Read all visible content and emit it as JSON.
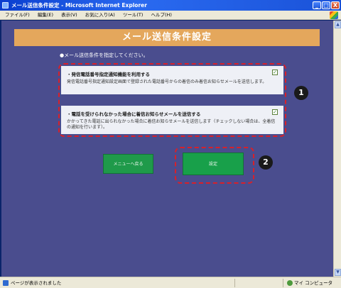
{
  "window": {
    "title": "メール送信条件設定 - Microsoft Internet Explorer",
    "minimize_glyph": "_",
    "maximize_glyph": "□",
    "close_glyph": "X"
  },
  "menubar": {
    "items": [
      "ファイル(F)",
      "編集(E)",
      "表示(V)",
      "お気に入り(A)",
      "ツール(T)",
      "ヘルプ(H)"
    ]
  },
  "page": {
    "title": "メール送信条件設定",
    "instruction": "●メール送信条件を指定してください。"
  },
  "options": [
    {
      "title": "・発信電話番号指定通知機能を利用する",
      "description": "発信電話番号指定通知設定画面で登録された電話番号からの着信のみ着信お知らせメールを送信します。",
      "checked_glyph": "✓"
    },
    {
      "title": "・電話を受けられなかった場合に着信お知らせメールを送信する",
      "description": "かかってきた電話に出られなかった場合に着信お知らせメールを送信します（チェックしない場合は、全着信の通知を行います）。",
      "checked_glyph": "✓"
    }
  ],
  "buttons": {
    "back_to_menu": "メニューへ戻る",
    "ok": "設定"
  },
  "callouts": {
    "badge_1": "1",
    "badge_2": "2",
    "color": "#d8202a"
  },
  "statusbar": {
    "text": "ページが表示されました",
    "zone": "マイ コンピュータ"
  },
  "colors": {
    "background": "#4a4d8e",
    "header": "#e4a75c",
    "button": "#1f9a4a"
  },
  "scrollbar": {
    "up_glyph": "▲",
    "down_glyph": "▼"
  }
}
